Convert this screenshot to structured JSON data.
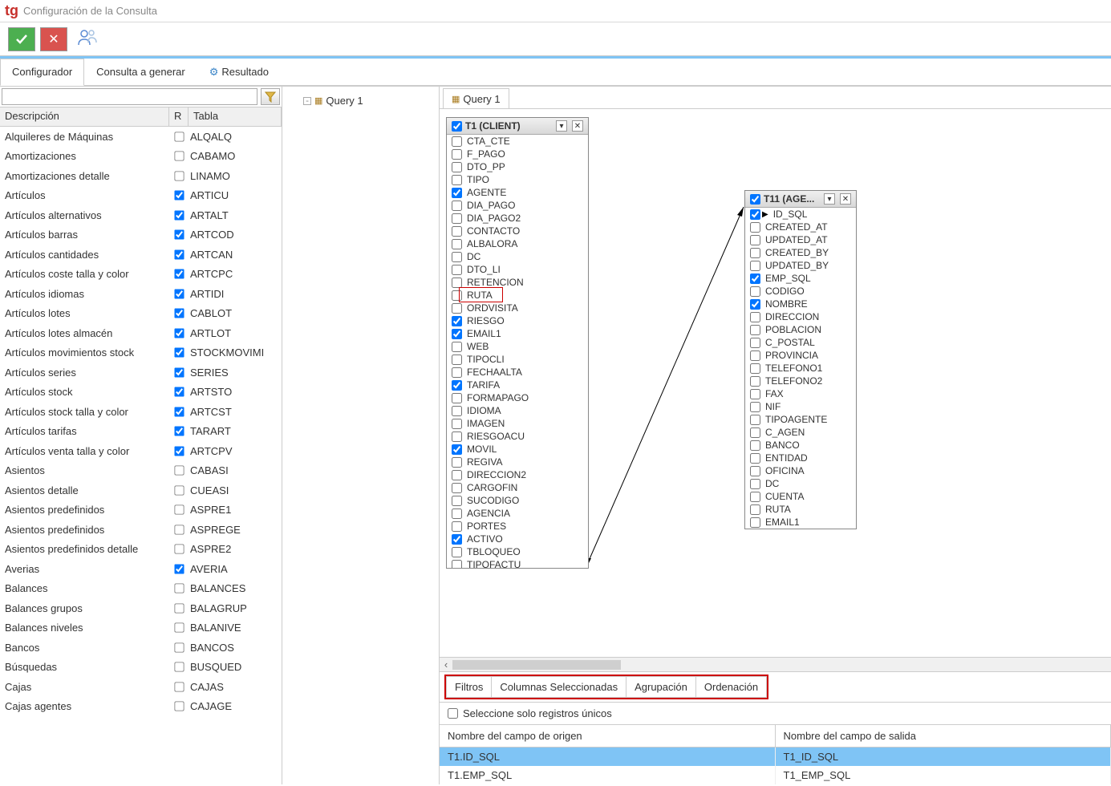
{
  "window": {
    "title": "Configuración de la Consulta",
    "logo": "tg"
  },
  "main_tabs": {
    "configurador": "Configurador",
    "consulta": "Consulta a generar",
    "resultado": "Resultado"
  },
  "tree": {
    "root": "Query 1"
  },
  "canvas_tab": "Query 1",
  "left_panel": {
    "headers": {
      "descripcion": "Descripción",
      "r": "R",
      "tabla": "Tabla"
    },
    "rows": [
      {
        "desc": "Alquileres de Máquinas",
        "r": false,
        "tabla": "ALQALQ"
      },
      {
        "desc": "Amortizaciones",
        "r": false,
        "tabla": "CABAMO"
      },
      {
        "desc": "Amortizaciones detalle",
        "r": false,
        "tabla": "LINAMO"
      },
      {
        "desc": "Artículos",
        "r": true,
        "tabla": "ARTICU"
      },
      {
        "desc": "Artículos alternativos",
        "r": true,
        "tabla": "ARTALT"
      },
      {
        "desc": "Artículos barras",
        "r": true,
        "tabla": "ARTCOD"
      },
      {
        "desc": "Artículos cantidades",
        "r": true,
        "tabla": "ARTCAN"
      },
      {
        "desc": "Artículos coste talla y color",
        "r": true,
        "tabla": "ARTCPC"
      },
      {
        "desc": "Artículos idiomas",
        "r": true,
        "tabla": "ARTIDI"
      },
      {
        "desc": "Artículos lotes",
        "r": true,
        "tabla": "CABLOT"
      },
      {
        "desc": "Artículos lotes almacén",
        "r": true,
        "tabla": "ARTLOT"
      },
      {
        "desc": "Artículos movimientos stock",
        "r": true,
        "tabla": "STOCKMOVIMI"
      },
      {
        "desc": "Artículos series",
        "r": true,
        "tabla": "SERIES"
      },
      {
        "desc": "Artículos stock",
        "r": true,
        "tabla": "ARTSTO"
      },
      {
        "desc": "Artículos stock talla y color",
        "r": true,
        "tabla": "ARTCST"
      },
      {
        "desc": "Artículos tarifas",
        "r": true,
        "tabla": "TARART"
      },
      {
        "desc": "Artículos venta talla y color",
        "r": true,
        "tabla": "ARTCPV"
      },
      {
        "desc": "Asientos",
        "r": false,
        "tabla": "CABASI"
      },
      {
        "desc": "Asientos detalle",
        "r": false,
        "tabla": "CUEASI"
      },
      {
        "desc": "Asientos predefinidos",
        "r": false,
        "tabla": "ASPRE1"
      },
      {
        "desc": "Asientos predefinidos",
        "r": false,
        "tabla": "ASPREGE"
      },
      {
        "desc": "Asientos predefinidos detalle",
        "r": false,
        "tabla": "ASPRE2"
      },
      {
        "desc": "Averias",
        "r": true,
        "tabla": "AVERIA"
      },
      {
        "desc": "Balances",
        "r": false,
        "tabla": "BALANCES"
      },
      {
        "desc": "Balances grupos",
        "r": false,
        "tabla": "BALAGRUP"
      },
      {
        "desc": "Balances niveles",
        "r": false,
        "tabla": "BALANIVE"
      },
      {
        "desc": "Bancos",
        "r": false,
        "tabla": "BANCOS"
      },
      {
        "desc": "Búsquedas",
        "r": false,
        "tabla": "BUSQUED"
      },
      {
        "desc": "Cajas",
        "r": false,
        "tabla": "CAJAS"
      },
      {
        "desc": "Cajas agentes",
        "r": false,
        "tabla": "CAJAGE"
      }
    ]
  },
  "table_t1": {
    "title": "T1 (CLIENT)",
    "fields": [
      {
        "name": "CTA_CTE",
        "checked": false
      },
      {
        "name": "F_PAGO",
        "checked": false
      },
      {
        "name": "DTO_PP",
        "checked": false
      },
      {
        "name": "TIPO",
        "checked": false
      },
      {
        "name": "AGENTE",
        "checked": true
      },
      {
        "name": "DIA_PAGO",
        "checked": false
      },
      {
        "name": "DIA_PAGO2",
        "checked": false
      },
      {
        "name": "CONTACTO",
        "checked": false
      },
      {
        "name": "ALBALORA",
        "checked": false
      },
      {
        "name": "DC",
        "checked": false
      },
      {
        "name": "DTO_LI",
        "checked": false
      },
      {
        "name": "RETENCION",
        "checked": false
      },
      {
        "name": "RUTA",
        "checked": false,
        "highlight": true
      },
      {
        "name": "ORDVISITA",
        "checked": false
      },
      {
        "name": "RIESGO",
        "checked": true
      },
      {
        "name": "EMAIL1",
        "checked": true
      },
      {
        "name": "WEB",
        "checked": false
      },
      {
        "name": "TIPOCLI",
        "checked": false
      },
      {
        "name": "FECHAALTA",
        "checked": false
      },
      {
        "name": "TARIFA",
        "checked": true
      },
      {
        "name": "FORMAPAGO",
        "checked": false
      },
      {
        "name": "IDIOMA",
        "checked": false
      },
      {
        "name": "IMAGEN",
        "checked": false
      },
      {
        "name": "RIESGOACU",
        "checked": false
      },
      {
        "name": "MOVIL",
        "checked": true
      },
      {
        "name": "REGIVA",
        "checked": false
      },
      {
        "name": "DIRECCION2",
        "checked": false
      },
      {
        "name": "CARGOFIN",
        "checked": false
      },
      {
        "name": "SUCODIGO",
        "checked": false
      },
      {
        "name": "AGENCIA",
        "checked": false
      },
      {
        "name": "PORTES",
        "checked": false
      },
      {
        "name": "ACTIVO",
        "checked": true
      },
      {
        "name": "TBLOQUEO",
        "checked": false
      },
      {
        "name": "TIPOFACTU",
        "checked": false
      }
    ]
  },
  "table_t11": {
    "title": "T11 (AGE...",
    "fields": [
      {
        "name": "ID_SQL",
        "checked": true,
        "key": true
      },
      {
        "name": "CREATED_AT",
        "checked": false
      },
      {
        "name": "UPDATED_AT",
        "checked": false
      },
      {
        "name": "CREATED_BY",
        "checked": false
      },
      {
        "name": "UPDATED_BY",
        "checked": false
      },
      {
        "name": "EMP_SQL",
        "checked": true
      },
      {
        "name": "CODIGO",
        "checked": false
      },
      {
        "name": "NOMBRE",
        "checked": true
      },
      {
        "name": "DIRECCION",
        "checked": false
      },
      {
        "name": "POBLACION",
        "checked": false
      },
      {
        "name": "C_POSTAL",
        "checked": false
      },
      {
        "name": "PROVINCIA",
        "checked": false
      },
      {
        "name": "TELEFONO1",
        "checked": false
      },
      {
        "name": "TELEFONO2",
        "checked": false
      },
      {
        "name": "FAX",
        "checked": false
      },
      {
        "name": "NIF",
        "checked": false
      },
      {
        "name": "TIPOAGENTE",
        "checked": false
      },
      {
        "name": "C_AGEN",
        "checked": false
      },
      {
        "name": "BANCO",
        "checked": false
      },
      {
        "name": "ENTIDAD",
        "checked": false
      },
      {
        "name": "OFICINA",
        "checked": false
      },
      {
        "name": "DC",
        "checked": false
      },
      {
        "name": "CUENTA",
        "checked": false
      },
      {
        "name": "RUTA",
        "checked": false
      },
      {
        "name": "EMAIL1",
        "checked": false
      }
    ]
  },
  "bottom": {
    "tabs": {
      "filtros": "Filtros",
      "columnas": "Columnas Seleccionadas",
      "agrupacion": "Agrupación",
      "ordenacion": "Ordenación"
    },
    "unique_label": "Seleccione solo registros únicos",
    "cols": {
      "head_origen": "Nombre del campo de origen",
      "head_salida": "Nombre del campo de salida",
      "rows": [
        {
          "origen": "T1.ID_SQL",
          "salida": "T1_ID_SQL",
          "selected": true
        },
        {
          "origen": "T1.EMP_SQL",
          "salida": "T1_EMP_SQL",
          "selected": false
        }
      ]
    }
  }
}
